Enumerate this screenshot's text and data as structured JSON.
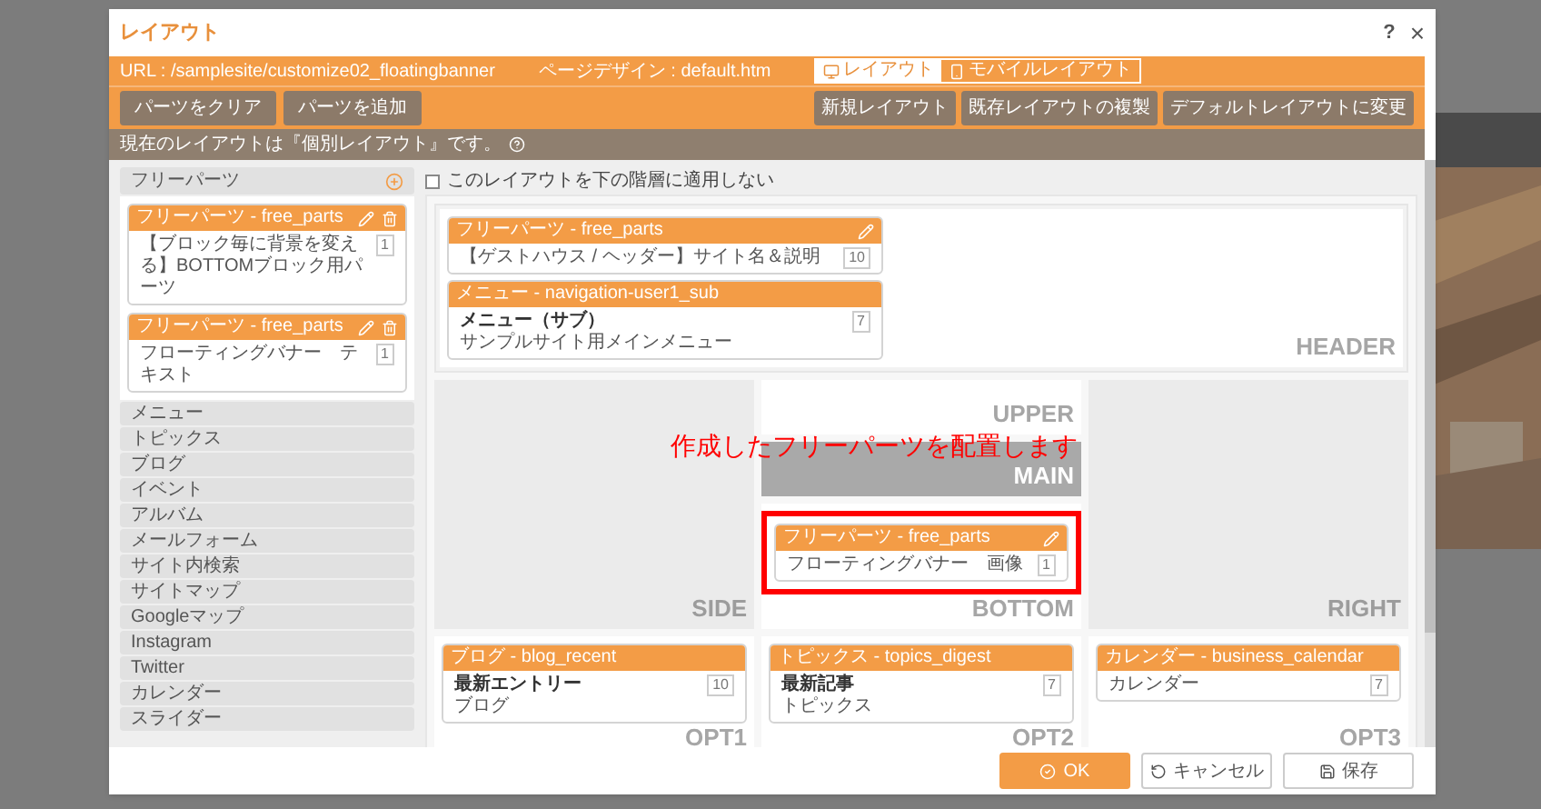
{
  "dialog": {
    "title": "レイアウト",
    "help": "?",
    "close": "×"
  },
  "info": {
    "url": "URL : /samplesite/customize02_floatingbanner",
    "page_design": "ページデザイン : default.htm"
  },
  "view_tabs": [
    {
      "kind": "desktop",
      "label": "レイアウト",
      "selected": true
    },
    {
      "kind": "mobile",
      "label": "モバイルレイアウト",
      "selected": false
    }
  ],
  "toolbar": {
    "left": [
      "パーツをクリア",
      "パーツを追加"
    ],
    "right": [
      "新規レイアウト",
      "既存レイアウトの複製",
      "デフォルトレイアウトに変更"
    ]
  },
  "notice": "現在のレイアウトは『個別レイアウト』です。",
  "sidebar": {
    "free_parts": {
      "label": "フリーパーツ",
      "parts": [
        {
          "header": "フリーパーツ - free_parts",
          "text": "【ブロック毎に背景を変える】BOTTOMブロック用パーツ",
          "count": "1"
        },
        {
          "header": "フリーパーツ - free_parts",
          "text": "フローティングバナー　テキスト",
          "count": "1"
        }
      ]
    },
    "categories": [
      "メニュー",
      "トピックス",
      "ブログ",
      "イベント",
      "アルバム",
      "メールフォーム",
      "サイト内検索",
      "サイトマップ",
      "Googleマップ",
      "Instagram",
      "Twitter",
      "カレンダー",
      "スライダー"
    ]
  },
  "apply_option": {
    "label": "このレイアウトを下の階層に適用しない",
    "checked": false
  },
  "layout": {
    "header": {
      "label": "HEADER",
      "kind": "plain",
      "parts": [
        {
          "header": "フリーパーツ - free_parts",
          "text": "【ゲストハウス / ヘッダー】サイト名＆説明",
          "count": "10",
          "editable": true,
          "highlighted": false
        },
        {
          "header": "メニュー - navigation-user1_sub",
          "title": "メニュー（サブ）",
          "text": "サンプルサイト用メインメニュー",
          "count": "7",
          "editable": false,
          "highlighted": false
        }
      ]
    },
    "side": {
      "label": "SIDE",
      "kind": "gray"
    },
    "upper": {
      "label": "UPPER",
      "kind": "plain"
    },
    "main": {
      "label": "MAIN",
      "kind": "dark"
    },
    "bottom": {
      "label": "BOTTOM",
      "kind": "plain",
      "parts": [
        {
          "header": "フリーパーツ - free_parts",
          "text": "フローティングバナー　画像",
          "count": "1",
          "editable": true,
          "highlighted": true
        }
      ]
    },
    "right": {
      "label": "RIGHT",
      "kind": "gray"
    },
    "opt1": {
      "label": "OPT1",
      "kind": "plain",
      "parts": [
        {
          "header": "ブログ - blog_recent",
          "title": "最新エントリー",
          "text": "ブログ",
          "count": "10",
          "editable": false,
          "highlighted": false
        }
      ]
    },
    "opt2": {
      "label": "OPT2",
      "kind": "plain",
      "parts": [
        {
          "header": "トピックス - topics_digest",
          "title": "最新記事",
          "text": "トピックス",
          "count": "7",
          "editable": false,
          "highlighted": false
        }
      ]
    },
    "opt3": {
      "label": "OPT3",
      "kind": "plain",
      "parts": [
        {
          "header": "カレンダー - business_calendar",
          "text": "カレンダー",
          "count": "7",
          "editable": false,
          "highlighted": false
        }
      ]
    }
  },
  "annotation": {
    "text": "作成したフリーパーツを配置します"
  },
  "footer_buttons": [
    {
      "kind": "ok",
      "label": "OK"
    },
    {
      "kind": "cancel",
      "label": "キャンセル"
    },
    {
      "kind": "save",
      "label": "保存"
    }
  ]
}
